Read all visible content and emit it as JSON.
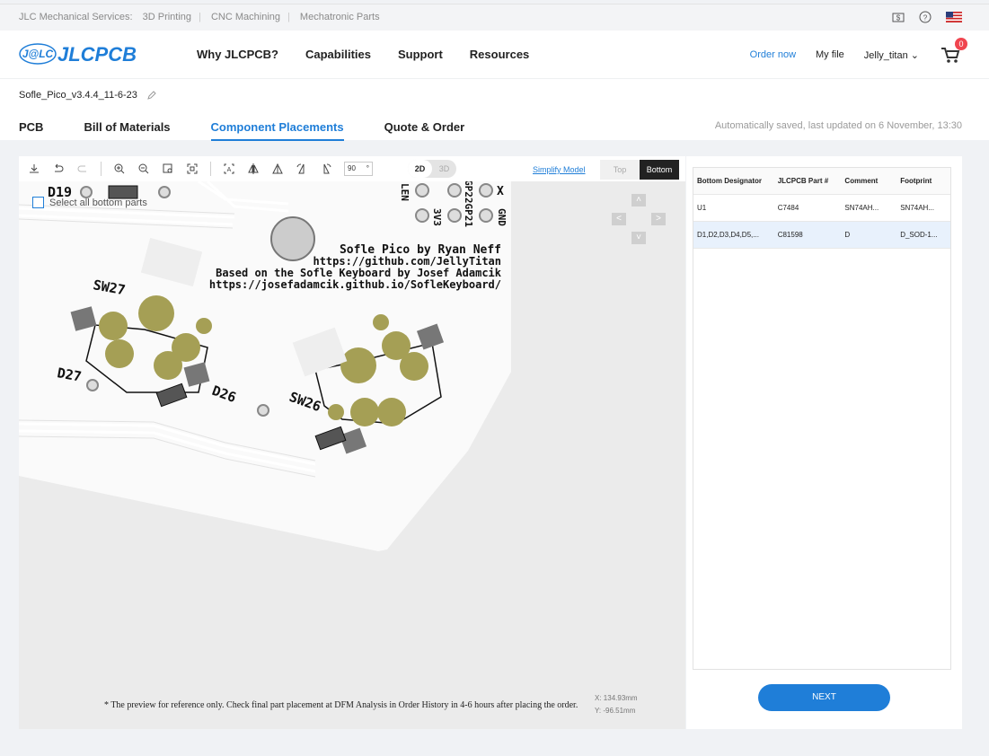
{
  "topbar": {
    "prefix": "JLC Mechanical Services:",
    "links": [
      "3D Printing",
      "CNC Machining",
      "Mechatronic Parts"
    ]
  },
  "header": {
    "logo_text": "JLCPCB",
    "logo_mark": "J@LC",
    "nav": [
      "Why JLCPCB?",
      "Capabilities",
      "Support",
      "Resources"
    ],
    "order_now": "Order now",
    "my_file": "My file",
    "user": "Jelly_titan",
    "cart_count": "0"
  },
  "project": {
    "filename": "Sofle_Pico_v3.4.4_11-6-23",
    "tabs": [
      "PCB",
      "Bill of Materials",
      "Component Placements",
      "Quote & Order"
    ],
    "active_tab": "Component Placements",
    "saved_text": "Automatically saved, last updated on 6 November, 13:30"
  },
  "viewer": {
    "rotation_value": "90",
    "rotation_unit": "°",
    "mode_2d": "2D",
    "mode_3d": "3D",
    "simplify": "Simplify Model",
    "side_top": "Top",
    "side_bottom": "Bottom",
    "select_all": "Select all bottom parts",
    "note": "* The preview for reference only. Check final part placement at DFM Analysis in Order History in 4-6 hours after placing the order.",
    "x_label": "X:",
    "x_value": "134.93mm",
    "y_label": "Y:",
    "y_value": "-96.51mm",
    "silk": {
      "l1": "Sofle Pico by Ryan Neff",
      "l2": "https://github.com/JellyTitan",
      "l3": "Based on the Sofle Keyboard by Josef Adamcik",
      "l4": "https://josefadamcik.github.io/SofleKeyboard/",
      "d19": "D19",
      "sw27": "SW27",
      "sw26": "SW26",
      "d27": "D27",
      "d26": "D26",
      "len": "LEN",
      "v3": "3V3",
      "gp": "GP22GP21",
      "gnd": "GND",
      "x": "X"
    }
  },
  "table": {
    "headers": [
      "Bottom Designator",
      "JLCPCB Part #",
      "Comment",
      "Footprint"
    ],
    "rows": [
      [
        "U1",
        "C7484",
        "SN74AH...",
        "SN74AH..."
      ],
      [
        "D1,D2,D3,D4,D5,...",
        "C81598",
        "D",
        "D_SOD-1..."
      ]
    ]
  },
  "next": "NEXT",
  "colors": {
    "accent": "#1f7ed8",
    "pad": "#a59f55",
    "badge": "#f0454f"
  }
}
